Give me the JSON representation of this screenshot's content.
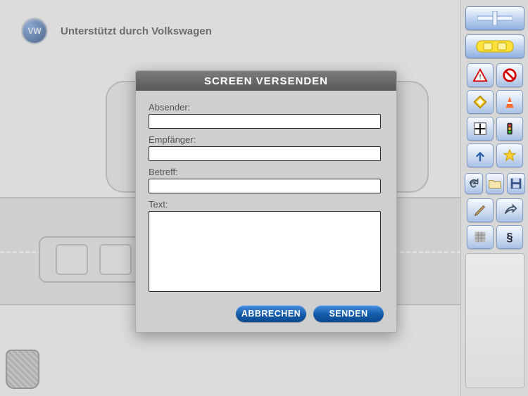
{
  "header": {
    "logo_letters": "VW",
    "tagline": "Unterstützt durch Volkswagen"
  },
  "dialog": {
    "title": "SCREEN VERSENDEN",
    "fields": {
      "sender_label": "Absender:",
      "recipient_label": "Empfänger:",
      "subject_label": "Betreff:",
      "body_label": "Text:",
      "sender_value": "",
      "recipient_value": "",
      "subject_value": "",
      "body_value": ""
    },
    "buttons": {
      "cancel": "ABBRECHEN",
      "send": "SENDEN"
    }
  },
  "toolbar": {
    "wide": [
      "new-sheet",
      "car-template"
    ],
    "small": [
      "warning-sign",
      "no-entry-sign",
      "priority-sign",
      "traffic-cone",
      "intersection-sign",
      "traffic-light",
      "direction-arrow",
      "star-favorite",
      "redo",
      "open-folder",
      "save-disk",
      "pencil-draw",
      "share-export",
      "grid-texture",
      "paragraph-sign"
    ]
  },
  "canvas": {
    "trash_name": "trash-bin"
  }
}
